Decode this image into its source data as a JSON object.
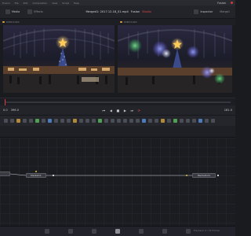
{
  "topbar": {
    "menu": [
      "Fusion",
      "File",
      "Edit",
      "Composition",
      "View",
      "Script",
      "Help"
    ],
    "app_title": "Fusion"
  },
  "toolbar": {
    "left_buttons": [
      "Media",
      "Effects"
    ],
    "center_title": "Fusion",
    "center_state": "Studio",
    "center_clip": "Merged1: 2017.12.18_01.mp4",
    "right_buttons": [
      "Inspector",
      "Merge1"
    ]
  },
  "viewers": {
    "left": {
      "label": "Merged1: 2017.12.18_01.mp4",
      "corner": "1080x1920"
    },
    "right": {
      "label": "Merge1",
      "corner": "1080x1920"
    }
  },
  "transport": {
    "start_tc": "0.0",
    "current_tc": "396.0",
    "end_tc": "181.0",
    "controls": [
      "⏮",
      "◀",
      "■",
      "▶",
      "⏭",
      "⟳"
    ]
  },
  "nodebar": {
    "tools": 34
  },
  "flow": {
    "nodes": [
      {
        "id": "n1",
        "label": ""
      },
      {
        "id": "n2",
        "label": "MediaIn1"
      },
      {
        "id": "n3",
        "label": "MediaOut1"
      }
    ]
  },
  "statusbar": {
    "pages": [
      "Media",
      "Cut",
      "Edit",
      "Fusion",
      "Color",
      "Fairlight",
      "Deliver"
    ],
    "active_page": "Fusion",
    "status": "Playback: 0 / 39 frames"
  },
  "colors": {
    "accent": "#e03b3b",
    "background": "#1a1b1f",
    "panel": "#23242a"
  }
}
